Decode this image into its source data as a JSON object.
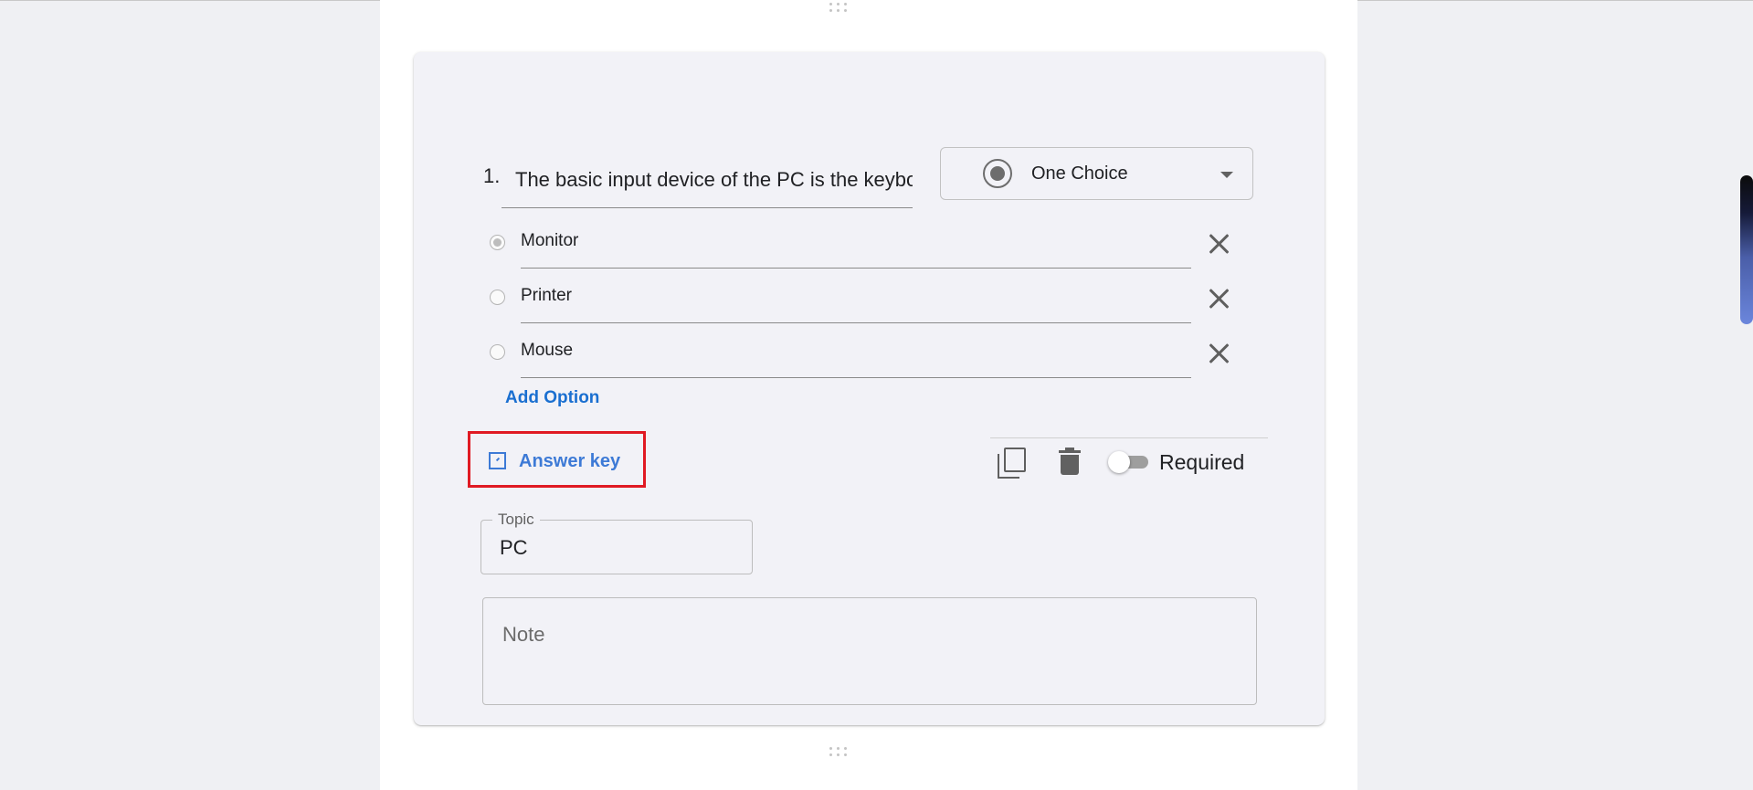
{
  "question": {
    "number": "1.",
    "text": "The basic input device of the PC is the keyboard"
  },
  "type_select": {
    "icon": "radio-button-icon",
    "selected": "One Choice"
  },
  "options": [
    {
      "label": "Monitor",
      "selected": true
    },
    {
      "label": "Printer",
      "selected": false
    },
    {
      "label": "Mouse",
      "selected": false
    }
  ],
  "add_option_label": "Add Option",
  "answer_key_label": "Answer key",
  "toolbar": {
    "required_label": "Required",
    "required_on": false
  },
  "topic": {
    "label": "Topic",
    "value": "PC"
  },
  "note": {
    "placeholder": "Note"
  },
  "colors": {
    "accent": "#1a6fd0",
    "answer_key": "#3d7ad6",
    "highlight_border": "#e01a23",
    "card_background": "#f2f2f7"
  }
}
